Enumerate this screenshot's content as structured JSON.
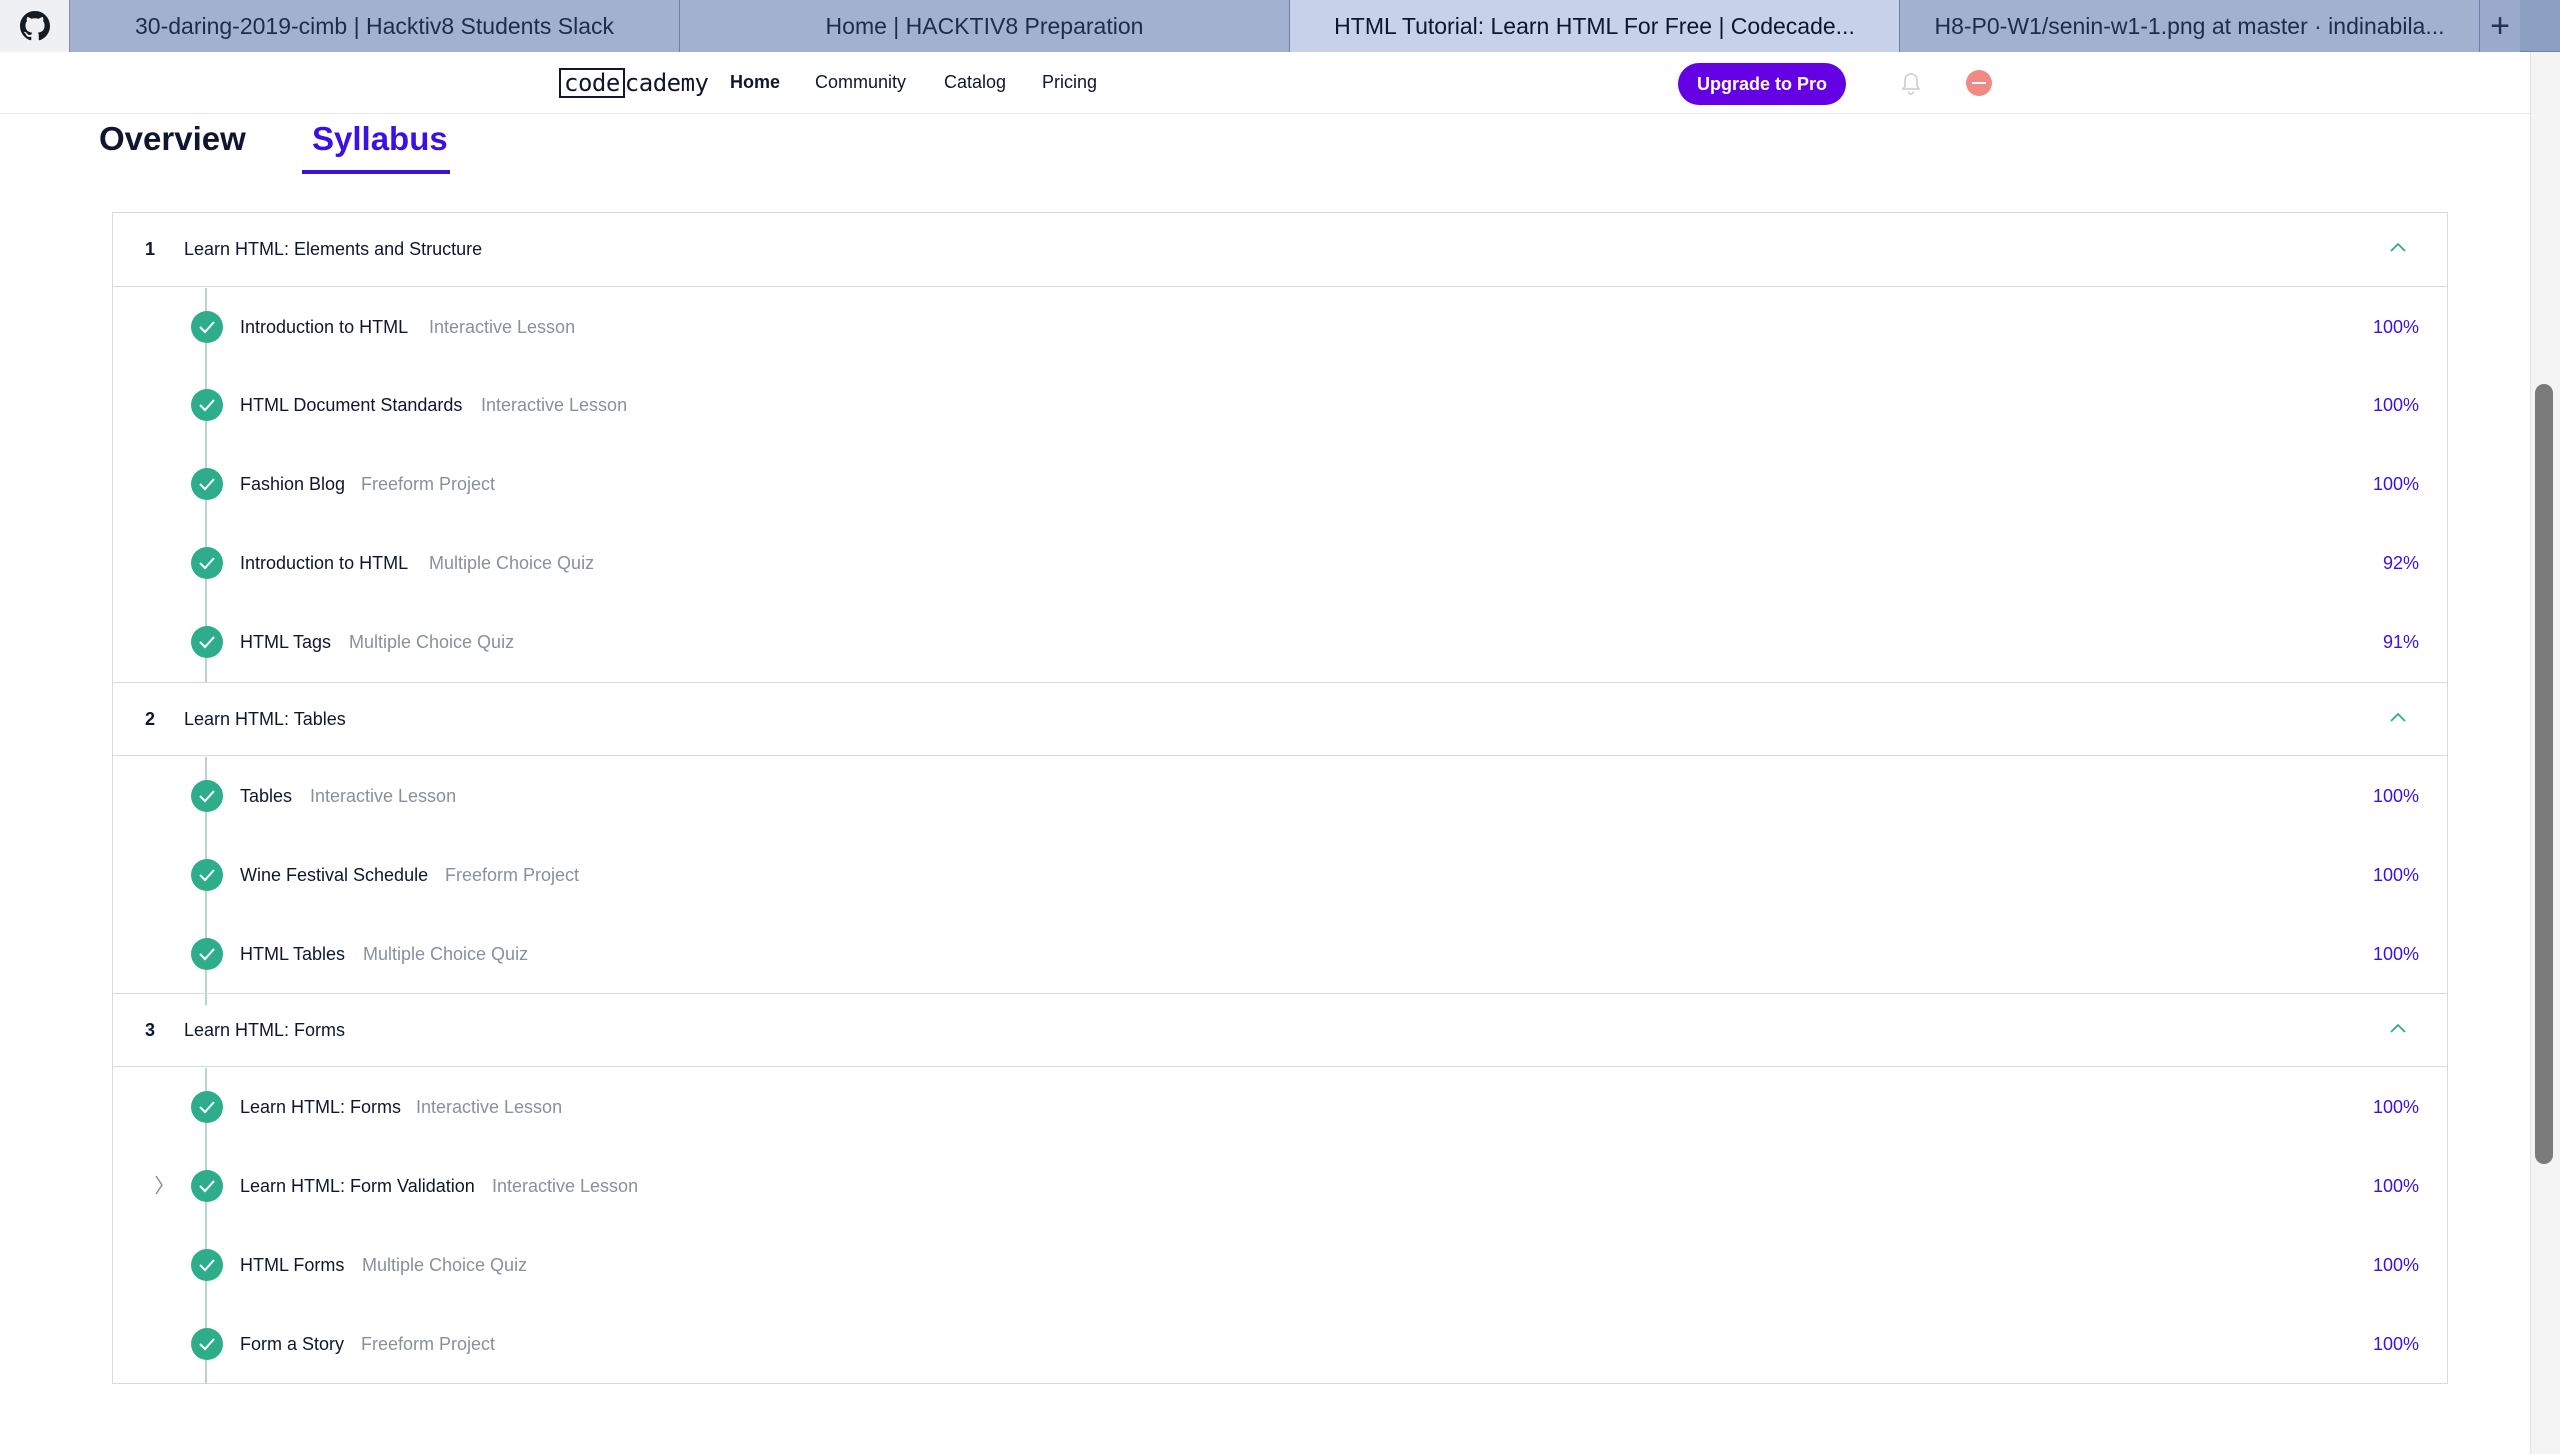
{
  "browser": {
    "tabs": [
      {
        "title": "30-daring-2019-cimb | Hacktiv8 Students Slack",
        "active": false
      },
      {
        "title": "Home | HACKTIV8 Preparation",
        "active": false
      },
      {
        "title": "HTML Tutorial: Learn HTML For Free | Codecade...",
        "active": true
      },
      {
        "title": "H8-P0-W1/senin-w1-1.png at master · indinabila...",
        "active": false
      }
    ],
    "new_tab_label": "+"
  },
  "nav": {
    "logo_code": "code",
    "logo_rest": "cademy",
    "links": [
      "Home",
      "Community",
      "Catalog",
      "Pricing"
    ],
    "upgrade_label": "Upgrade to Pro"
  },
  "page_tabs": {
    "overview": "Overview",
    "syllabus": "Syllabus"
  },
  "modules": [
    {
      "number": "1",
      "title": "Learn HTML: Elements and Structure",
      "lessons": [
        {
          "name": "Introduction to HTML",
          "type": "Interactive Lesson",
          "progress": "100%"
        },
        {
          "name": "HTML Document Standards",
          "type": "Interactive Lesson",
          "progress": "100%"
        },
        {
          "name": "Fashion Blog",
          "type": "Freeform Project",
          "progress": "100%"
        },
        {
          "name": "Introduction to HTML",
          "type": "Multiple Choice Quiz",
          "progress": "92%"
        },
        {
          "name": "HTML Tags",
          "type": "Multiple Choice Quiz",
          "progress": "91%"
        }
      ]
    },
    {
      "number": "2",
      "title": "Learn HTML: Tables",
      "lessons": [
        {
          "name": "Tables",
          "type": "Interactive Lesson",
          "progress": "100%"
        },
        {
          "name": "Wine Festival Schedule",
          "type": "Freeform Project",
          "progress": "100%"
        },
        {
          "name": "HTML Tables",
          "type": "Multiple Choice Quiz",
          "progress": "100%"
        }
      ]
    },
    {
      "number": "3",
      "title": "Learn HTML: Forms",
      "lessons": [
        {
          "name": "Learn HTML: Forms",
          "type": "Interactive Lesson",
          "progress": "100%"
        },
        {
          "name": "Learn HTML: Form Validation",
          "type": "Interactive Lesson",
          "progress": "100%"
        },
        {
          "name": "HTML Forms",
          "type": "Multiple Choice Quiz",
          "progress": "100%"
        },
        {
          "name": "Form a Story",
          "type": "Freeform Project",
          "progress": "100%"
        }
      ]
    }
  ],
  "colors": {
    "accent": "#3a10e5",
    "upgrade": "#6400e4",
    "complete": "#2ead8b"
  }
}
